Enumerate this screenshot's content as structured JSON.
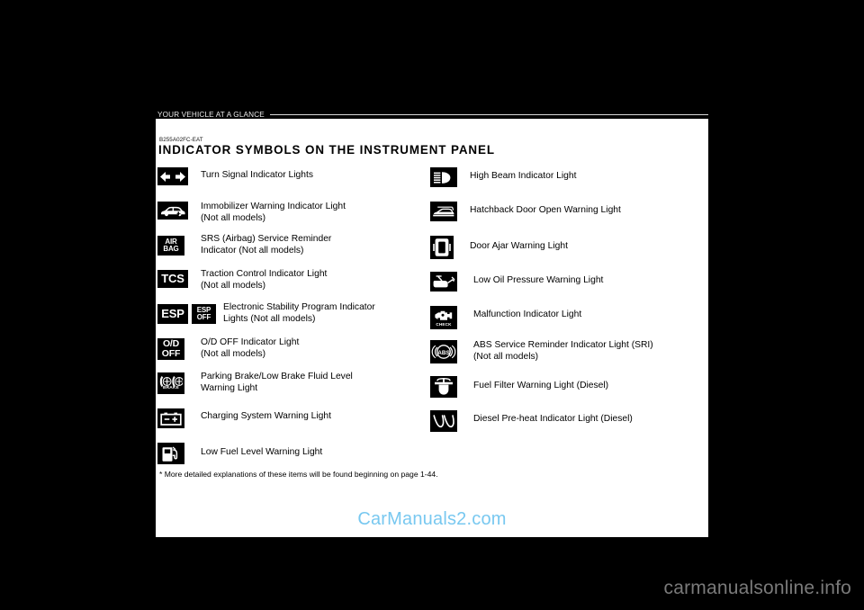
{
  "running_header": {
    "text": "YOUR VEHICLE AT A GLANCE"
  },
  "section": {
    "code": "B255A02FC-EAT",
    "title": "INDICATOR SYMBOLS ON THE INSTRUMENT PANEL"
  },
  "colors": {
    "page_background": "#ffffff",
    "screen_background": "#000000",
    "icon_tile": "#000000",
    "icon_glyph": "#ffffff",
    "text": "#000000",
    "watermark_page": "#78c8f0",
    "watermark_bottom": "#7a7a7a"
  },
  "left_column": [
    {
      "icons": [
        "turn-signal-arrows-icon"
      ],
      "label": "Turn Signal Indicator Lights"
    },
    {
      "icons": [
        "immobilizer-car-icon"
      ],
      "label": "Immobilizer Warning Indicator Light\n(Not all models)"
    },
    {
      "icons": [
        "air-bag-text-icon"
      ],
      "label": "SRS (Airbag) Service Reminder\nIndicator (Not all models)"
    },
    {
      "icons": [
        "tcs-text-icon"
      ],
      "label": "Traction Control Indicator Light\n(Not all models)"
    },
    {
      "icons": [
        "esp-text-icon",
        "esp-off-text-icon"
      ],
      "label": "Electronic Stability Program Indicator\nLights (Not all models)"
    },
    {
      "icons": [
        "od-off-text-icon"
      ],
      "label": "O/D OFF Indicator Light\n(Not all models)"
    },
    {
      "icons": [
        "parking-brake-icon"
      ],
      "label": "Parking Brake/Low Brake Fluid Level\nWarning Light"
    },
    {
      "icons": [
        "battery-charging-icon"
      ],
      "label": "Charging System Warning Light"
    },
    {
      "icons": [
        "fuel-pump-icon"
      ],
      "label": "Low Fuel Level Warning Light"
    }
  ],
  "right_column": [
    {
      "icons": [
        "high-beam-icon"
      ],
      "label": "High Beam Indicator Light"
    },
    {
      "icons": [
        "hatchback-door-open-icon"
      ],
      "label": "Hatchback Door Open Warning Light"
    },
    {
      "icons": [
        "door-ajar-icon"
      ],
      "label": "Door Ajar Warning Light"
    },
    {
      "icons": [
        "oil-can-icon"
      ],
      "label": "Low Oil Pressure Warning Light"
    },
    {
      "icons": [
        "check-engine-icon"
      ],
      "label": "Malfunction Indicator Light"
    },
    {
      "icons": [
        "abs-icon"
      ],
      "label": "ABS Service Reminder Indicator Light (SRI)\n(Not all models)"
    },
    {
      "icons": [
        "fuel-filter-icon"
      ],
      "label": "Fuel Filter Warning Light (Diesel)"
    },
    {
      "icons": [
        "diesel-preheat-coil-icon"
      ],
      "label": "Diesel Pre-heat Indicator Light (Diesel)"
    }
  ],
  "icon_text_labels": {
    "air_bag": [
      "AIR",
      "BAG"
    ],
    "tcs": [
      "TCS"
    ],
    "esp": [
      "ESP"
    ],
    "esp_off": [
      "ESP",
      "OFF"
    ],
    "od_off": [
      "O/D",
      "OFF"
    ],
    "brake": [
      "BRAKE"
    ],
    "check": [
      "CHECK"
    ],
    "abs": [
      "ABS"
    ]
  },
  "footnote": "* More detailed explanations of these items will be found beginning on page 1-44.",
  "watermarks": {
    "page": "CarManuals2.com",
    "bottom": "carmanualsonline.info"
  }
}
